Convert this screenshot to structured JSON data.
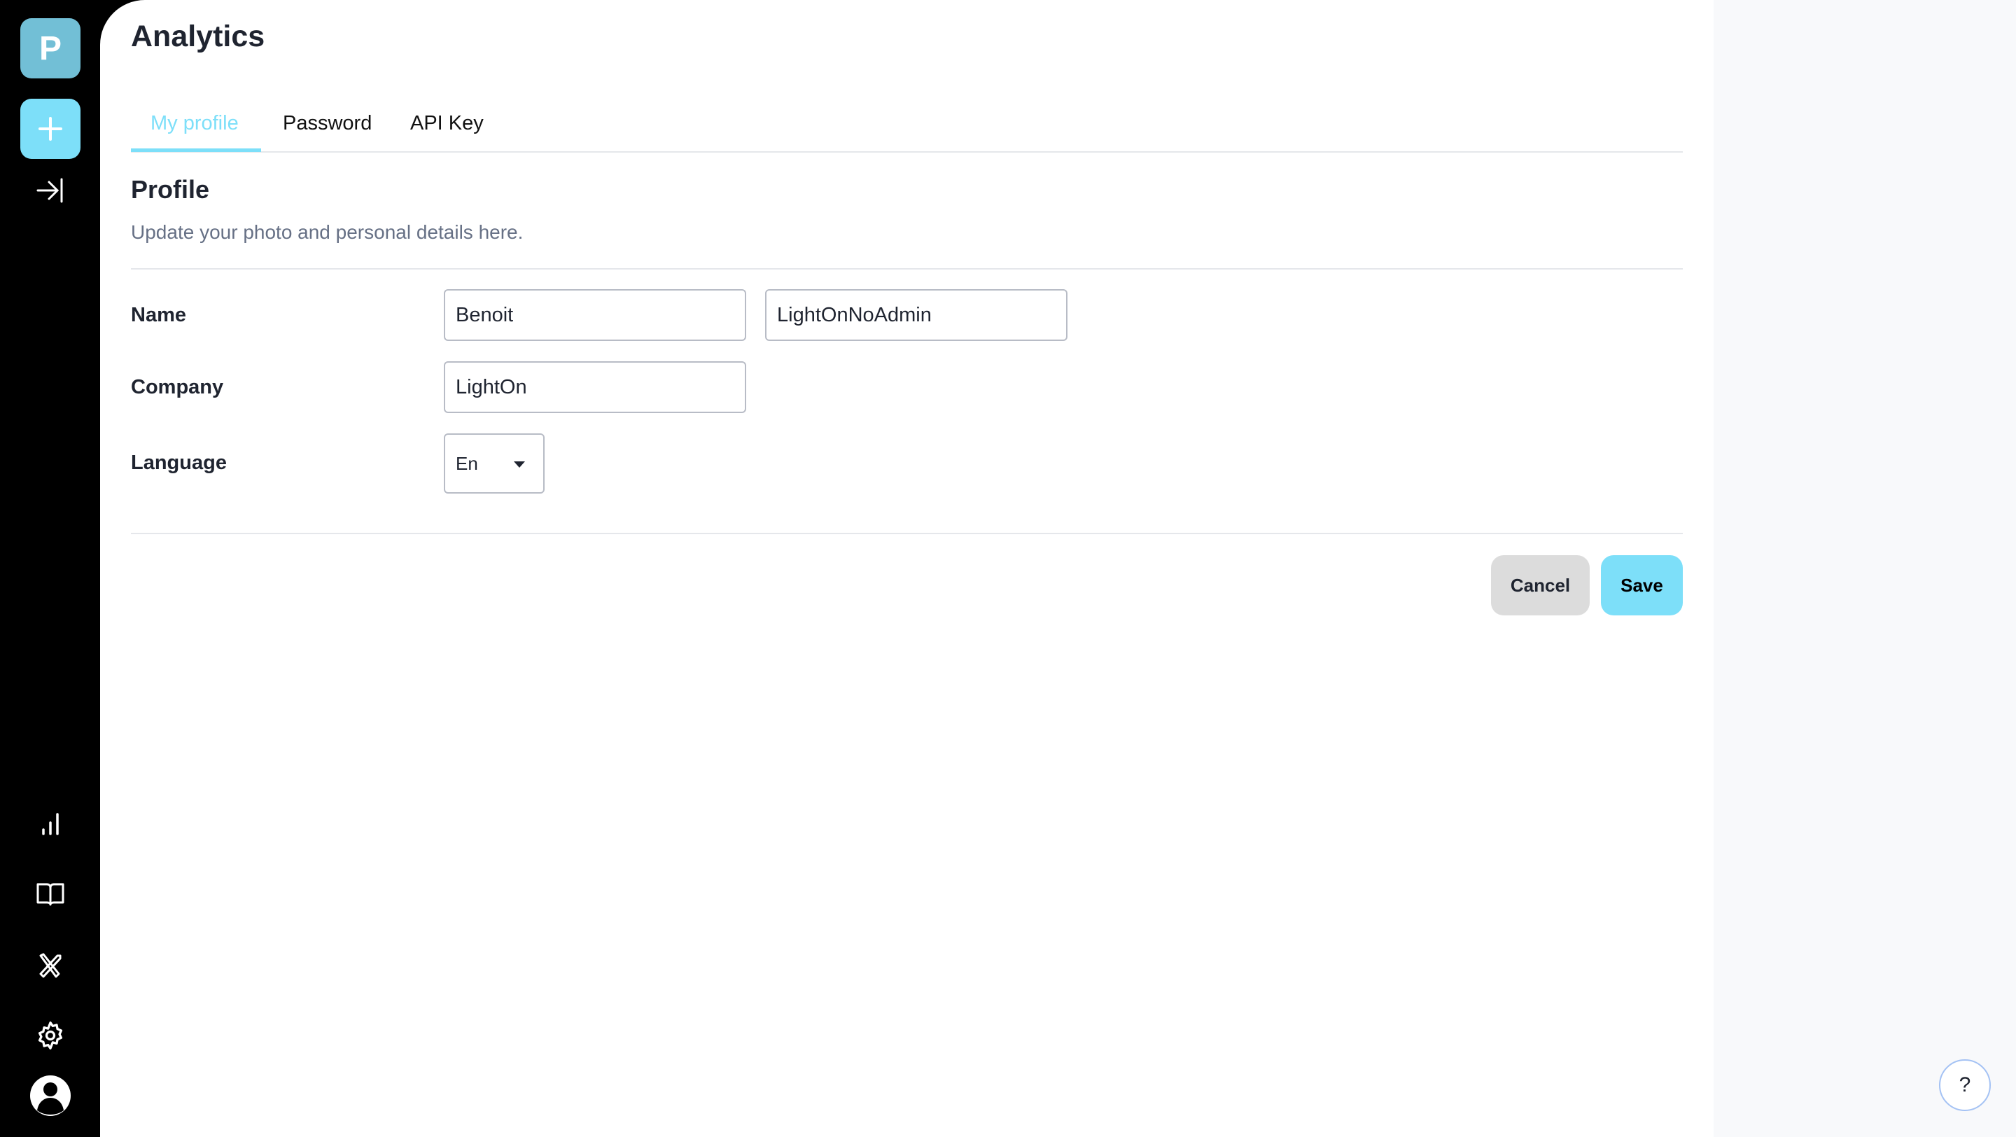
{
  "sidebar": {
    "logo_letter": "P",
    "logo_color": "#72bfd6",
    "new_button_color": "#7ddff9",
    "icons": [
      "plus-icon",
      "collapse-arrow-icon",
      "bar-chart-icon",
      "book-icon",
      "tools-icon",
      "gear-icon",
      "user-avatar-icon"
    ]
  },
  "header": {
    "title": "Analytics"
  },
  "tabs": [
    {
      "label": "My profile",
      "active": true
    },
    {
      "label": "Password",
      "active": false
    },
    {
      "label": "API Key",
      "active": false
    }
  ],
  "profile": {
    "heading": "Profile",
    "subtitle": "Update your photo and personal details here.",
    "fields": {
      "name_label": "Name",
      "first_name": "Benoit",
      "last_name": "LightOnNoAdmin",
      "company_label": "Company",
      "company": "LightOn",
      "language_label": "Language",
      "language": "En"
    },
    "cancel_label": "Cancel",
    "save_label": "Save"
  },
  "colors": {
    "accent": "#7ddff9",
    "cancel_bg": "#dcdcdc"
  },
  "help": {
    "label": "?"
  }
}
